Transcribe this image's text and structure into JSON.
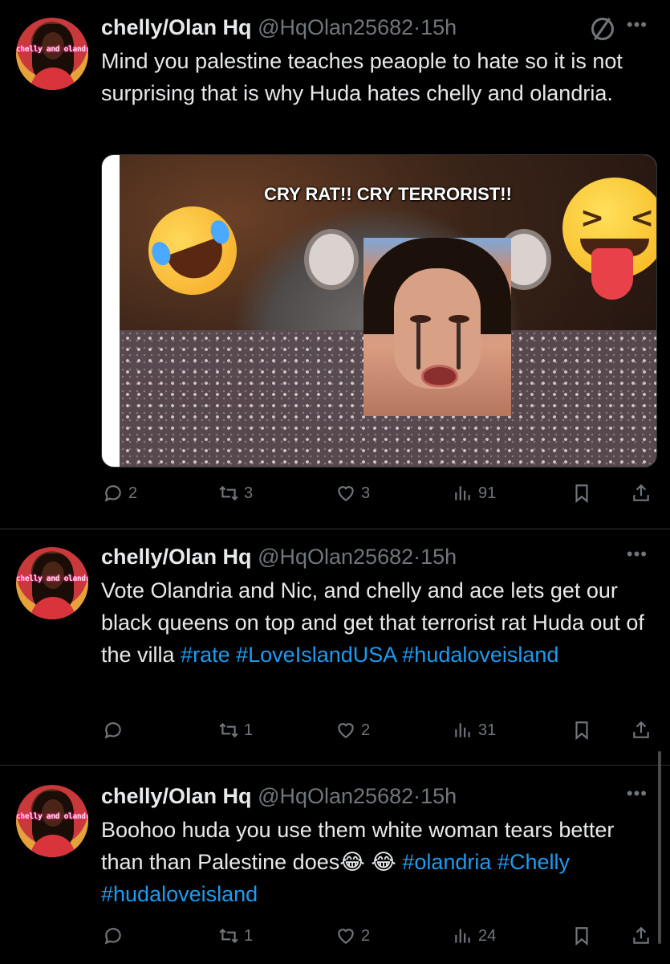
{
  "tweets": [
    {
      "avatar_text": "chelly and olandria HQ",
      "name": "chelly/Olan Hq",
      "handle": "@HqOlan25682",
      "sep": "·",
      "time": "15h",
      "text": "Mind you palestine teaches peaople to hate so it is not surprising that is why Huda hates chelly and olandria.",
      "media": {
        "caption": "CRY RAT!! CRY TERRORIST!!"
      },
      "replies": "2",
      "reposts": "3",
      "likes": "3",
      "views": "91"
    },
    {
      "avatar_text": "chelly and olandria HQ",
      "name": "chelly/Olan Hq",
      "handle": "@HqOlan25682",
      "sep": "·",
      "time": "15h",
      "text_plain": "Vote Olandria and Nic, and chelly and ace lets get our black queens on top and get  that terrorist rat Huda out of the villa",
      "hashtags": [
        "#rate",
        "#LoveIslandUSA",
        "#hudaloveisland"
      ],
      "replies": "",
      "reposts": "1",
      "likes": "2",
      "views": "31"
    },
    {
      "avatar_text": "chelly and olandria HQ",
      "name": "chelly/Olan Hq",
      "handle": "@HqOlan25682",
      "sep": "·",
      "time": "15h",
      "text_plain": "Boohoo huda you use them white woman tears better than than Palestine does😂 😂",
      "hashtags": [
        "#olandria",
        "#Chelly",
        "#hudaloveisland"
      ],
      "replies": "",
      "reposts": "1",
      "likes": "2",
      "views": "24"
    }
  ],
  "icons": {
    "reply": "reply-icon",
    "repost": "repost-icon",
    "like": "heart-icon",
    "views": "views-icon",
    "bookmark": "bookmark-icon",
    "share": "share-icon",
    "more": "more-icon",
    "not_interested": "not-interested-icon"
  },
  "colors": {
    "background": "#000000",
    "text": "#e7e9ea",
    "muted": "#71767b",
    "link": "#1d9bf0"
  }
}
